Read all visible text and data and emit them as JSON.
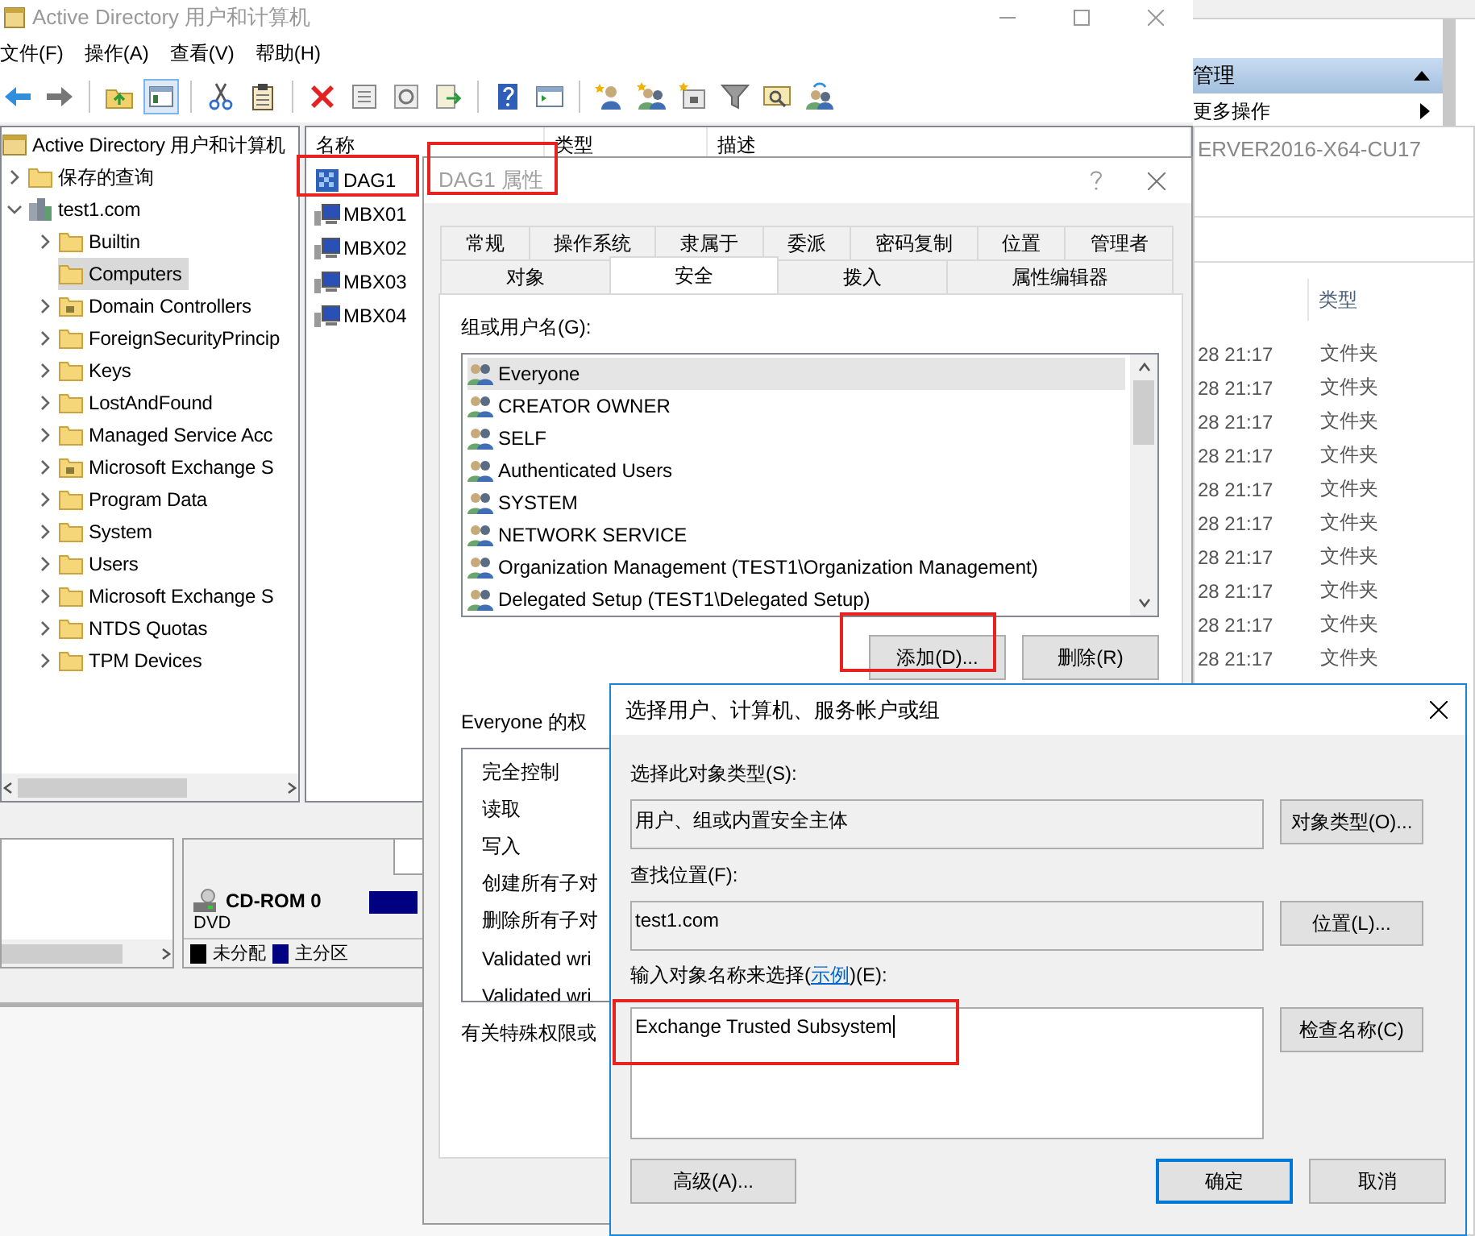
{
  "main_window": {
    "title": "Active Directory 用户和计算机",
    "menu": [
      "文件(F)",
      "操作(A)",
      "查看(V)",
      "帮助(H)"
    ],
    "tree": {
      "root": "Active Directory 用户和计算机",
      "items": [
        {
          "label": "保存的查询",
          "kind": "folder",
          "expandable": true,
          "expanded": false,
          "selected": false
        },
        {
          "label": "test1.com",
          "kind": "domain",
          "expandable": true,
          "expanded": true,
          "selected": false,
          "children": [
            {
              "label": "Builtin",
              "kind": "folder",
              "expandable": true,
              "expanded": false,
              "selected": false
            },
            {
              "label": "Computers",
              "kind": "folder",
              "expandable": false,
              "expanded": false,
              "selected": true
            },
            {
              "label": "Domain Controllers",
              "kind": "ou",
              "expandable": true,
              "expanded": false,
              "selected": false
            },
            {
              "label": "ForeignSecurityPrincip",
              "kind": "folder",
              "expandable": true,
              "expanded": false,
              "selected": false
            },
            {
              "label": "Keys",
              "kind": "folder",
              "expandable": true,
              "expanded": false,
              "selected": false
            },
            {
              "label": "LostAndFound",
              "kind": "folder",
              "expandable": true,
              "expanded": false,
              "selected": false
            },
            {
              "label": "Managed Service Acc",
              "kind": "folder",
              "expandable": true,
              "expanded": false,
              "selected": false
            },
            {
              "label": "Microsoft Exchange S",
              "kind": "ou",
              "expandable": true,
              "expanded": false,
              "selected": false
            },
            {
              "label": "Program Data",
              "kind": "folder",
              "expandable": true,
              "expanded": false,
              "selected": false
            },
            {
              "label": "System",
              "kind": "folder",
              "expandable": true,
              "expanded": false,
              "selected": false
            },
            {
              "label": "Users",
              "kind": "folder",
              "expandable": true,
              "expanded": false,
              "selected": false
            },
            {
              "label": "Microsoft Exchange S",
              "kind": "folder",
              "expandable": true,
              "expanded": false,
              "selected": false
            },
            {
              "label": "NTDS Quotas",
              "kind": "folder",
              "expandable": true,
              "expanded": false,
              "selected": false
            },
            {
              "label": "TPM Devices",
              "kind": "folder",
              "expandable": true,
              "expanded": false,
              "selected": false
            }
          ]
        }
      ]
    },
    "list": {
      "columns": [
        "名称",
        "类型",
        "描述"
      ],
      "rows": [
        {
          "name": "DAG1",
          "kind": "dag"
        },
        {
          "name": "MBX01",
          "kind": "computer"
        },
        {
          "name": "MBX02",
          "kind": "computer"
        },
        {
          "name": "MBX03",
          "kind": "computer"
        },
        {
          "name": "MBX04",
          "kind": "computer"
        }
      ]
    },
    "disk": {
      "device": "CD-ROM 0",
      "media": "DVD",
      "legend": [
        {
          "label": "未分配",
          "color": "#000000"
        },
        {
          "label": "主分区",
          "color": "#000080"
        }
      ]
    }
  },
  "action_pane": {
    "header": "管理",
    "items": [
      "更多操作"
    ]
  },
  "explorer": {
    "title": "ERVER2016-X64-CU17",
    "column": "类型",
    "rows": [
      {
        "modified": "28 21:17",
        "type": "文件夹"
      },
      {
        "modified": "28 21:17",
        "type": "文件夹"
      },
      {
        "modified": "28 21:17",
        "type": "文件夹"
      },
      {
        "modified": "28 21:17",
        "type": "文件夹"
      },
      {
        "modified": "28 21:17",
        "type": "文件夹"
      },
      {
        "modified": "28 21:17",
        "type": "文件夹"
      },
      {
        "modified": "28 21:17",
        "type": "文件夹"
      },
      {
        "modified": "28 21:17",
        "type": "文件夹"
      },
      {
        "modified": "28 21:17",
        "type": "文件夹"
      },
      {
        "modified": "28 21:17",
        "type": "文件夹"
      }
    ]
  },
  "properties_dialog": {
    "title": "DAG1 属性",
    "tab_rows": [
      [
        {
          "label": "常规",
          "selected": false
        },
        {
          "label": "操作系统",
          "selected": false
        },
        {
          "label": "隶属于",
          "selected": false
        },
        {
          "label": "委派",
          "selected": false
        },
        {
          "label": "密码复制",
          "selected": false
        },
        {
          "label": "位置",
          "selected": false
        },
        {
          "label": "管理者",
          "selected": false
        }
      ],
      [
        {
          "label": "对象",
          "selected": false
        },
        {
          "label": "安全",
          "selected": true
        },
        {
          "label": "拨入",
          "selected": false
        },
        {
          "label": "属性编辑器",
          "selected": false
        }
      ]
    ],
    "groups_label": "组或用户名(G):",
    "groups": [
      {
        "name": "Everyone",
        "selected": true
      },
      {
        "name": "CREATOR OWNER",
        "selected": false
      },
      {
        "name": "SELF",
        "selected": false
      },
      {
        "name": "Authenticated Users",
        "selected": false
      },
      {
        "name": "SYSTEM",
        "selected": false
      },
      {
        "name": "NETWORK SERVICE",
        "selected": false
      },
      {
        "name": "Organization Management (TEST1\\Organization Management)",
        "selected": false
      },
      {
        "name": "Delegated Setup (TEST1\\Delegated Setup)",
        "selected": false
      }
    ],
    "group_buttons": [
      "添加(D)...",
      "删除(R)"
    ],
    "permissions_label": "Everyone 的权",
    "permissions": [
      "完全控制",
      "读取",
      "写入",
      "创建所有子对",
      "删除所有子对",
      "Validated wri",
      "Validated wri"
    ],
    "footer_note": "有关特殊权限或"
  },
  "select_dialog": {
    "title": "选择用户、计算机、服务帐户或组",
    "object_type": {
      "label": "选择此对象类型(S):",
      "value": "用户、组或内置安全主体",
      "button": "对象类型(O)..."
    },
    "location": {
      "label": "查找位置(F):",
      "value": "test1.com",
      "button": "位置(L)..."
    },
    "names": {
      "label_before": "输入对象名称来选择(",
      "link": "示例",
      "label_after": ")(E):",
      "value": "Exchange Trusted Subsystem",
      "button": "检查名称(C)"
    },
    "buttons": [
      {
        "label": "高级(A)...",
        "default": false
      },
      {
        "label": "确定",
        "default": true
      },
      {
        "label": "取消",
        "default": false
      }
    ]
  }
}
